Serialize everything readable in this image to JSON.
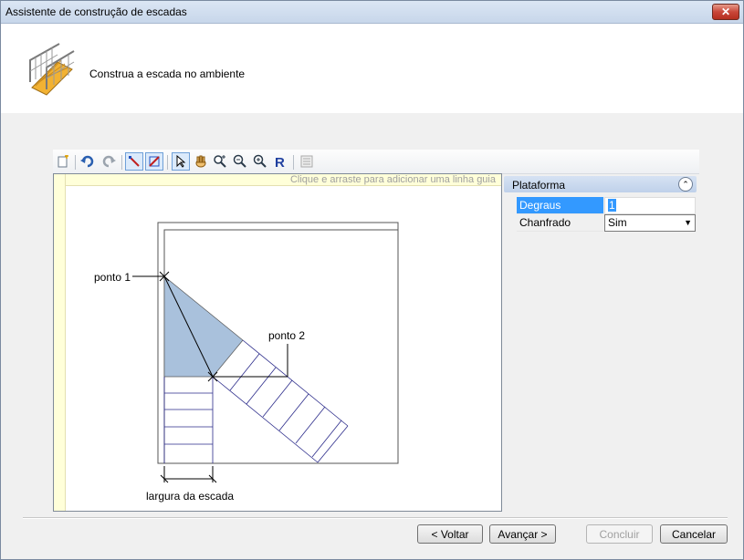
{
  "window": {
    "title": "Assistente de construção de escadas",
    "close_label": "✕"
  },
  "header": {
    "instruction": "Construa a escada no ambiente",
    "icon": "stair-icon"
  },
  "toolbar": {
    "items": [
      "new-icon",
      "undo-icon",
      "redo-icon",
      "draw-line-icon",
      "draw-arc-icon",
      "select-icon",
      "pan-icon",
      "zoom-window-icon",
      "zoom-out-icon",
      "zoom-in-icon",
      "regenerate-icon",
      "properties-icon"
    ]
  },
  "canvas": {
    "ruler_hint": "Clique e arraste para adicionar uma linha guia",
    "labels": {
      "point1": "ponto 1",
      "point2": "ponto 2",
      "width": "largura da escada"
    },
    "colors": {
      "landing_fill": "#a9c1dc",
      "step_stroke": "#2a2a8a"
    }
  },
  "properties": {
    "section": "Plataforma",
    "rows": [
      {
        "name": "Degraus",
        "value": "1"
      },
      {
        "name": "Chanfrado",
        "value": "Sim"
      }
    ]
  },
  "buttons": {
    "back": "< Voltar",
    "next": "Avançar >",
    "finish": "Concluir",
    "cancel": "Cancelar"
  }
}
